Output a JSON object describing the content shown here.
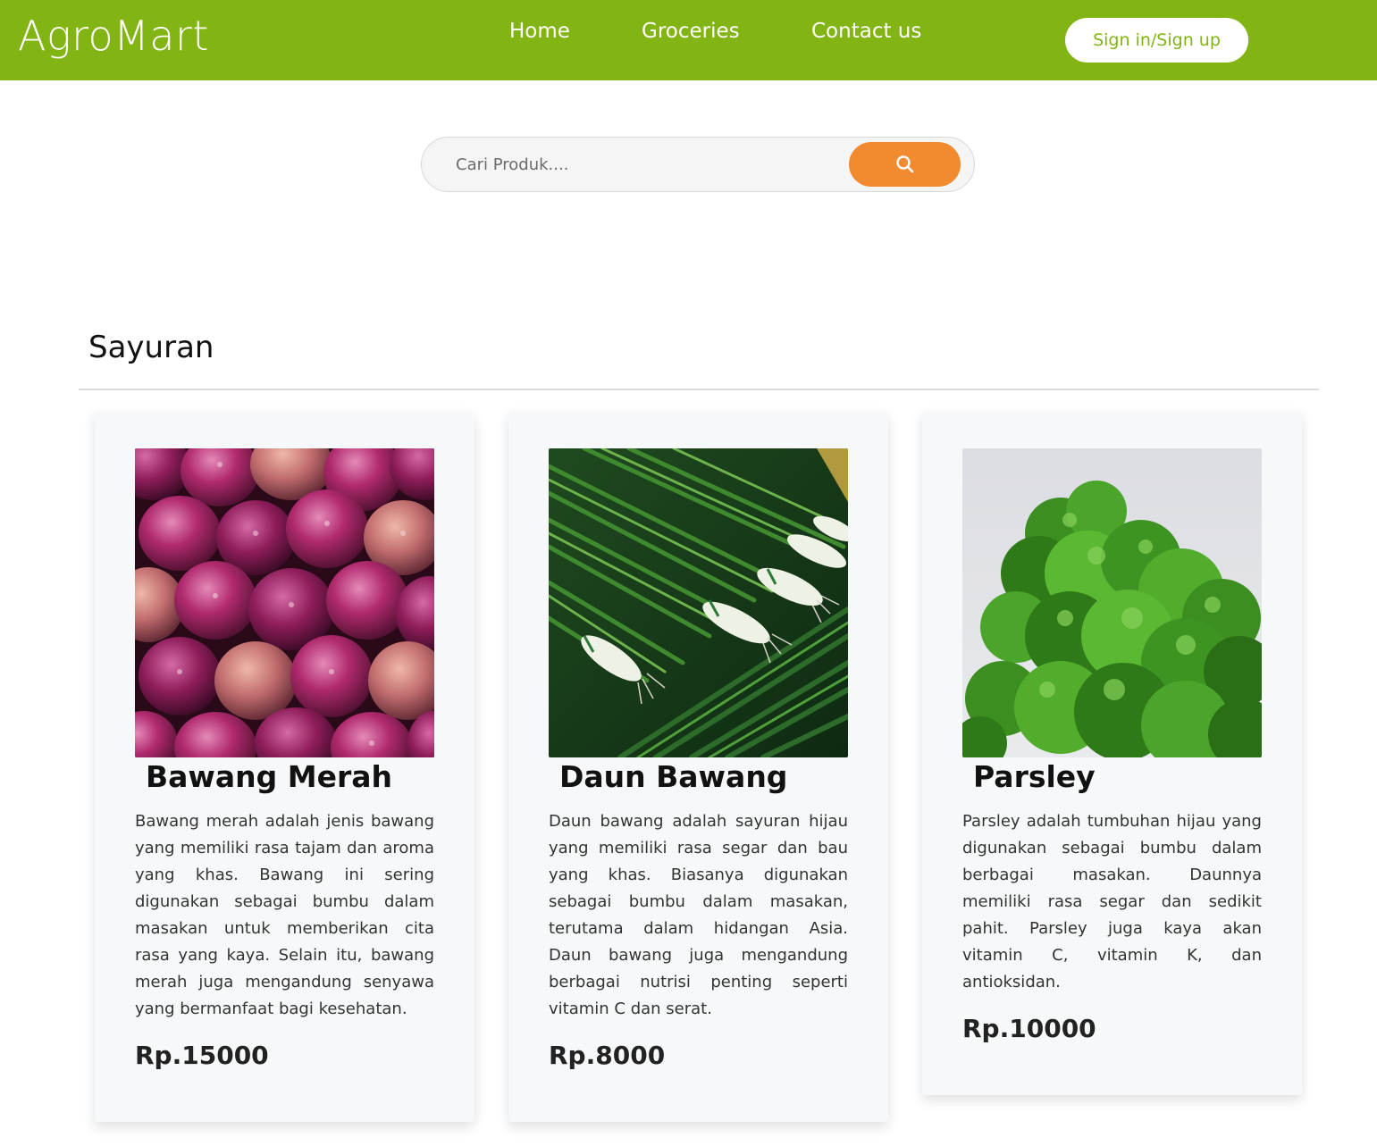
{
  "navbar": {
    "brand": "AgroMart",
    "links": [
      "Home",
      "Groceries",
      "Contact us"
    ],
    "signin_label": "Sign in/Sign up",
    "bg_color": "#82b414"
  },
  "search": {
    "placeholder": "Cari Produk....",
    "value": "",
    "button_icon": "search-icon",
    "button_color": "#f28a30"
  },
  "section": {
    "title": "Sayuran"
  },
  "products": [
    {
      "name": "Bawang Merah",
      "image": "red-onions-photo",
      "description": "Bawang merah adalah jenis bawang yang memiliki rasa tajam dan aroma yang khas. Bawang ini sering digunakan sebagai bumbu dalam masakan untuk memberikan cita rasa yang kaya. Selain itu, bawang merah juga mengandung senyawa yang bermanfaat bagi kesehatan.",
      "price": "Rp.15000"
    },
    {
      "name": "Daun Bawang",
      "image": "green-onions-photo",
      "description": "Daun bawang adalah sayuran hijau yang memiliki rasa segar dan bau yang khas. Biasanya digunakan sebagai bumbu dalam masakan, terutama dalam hidangan Asia. Daun bawang juga mengandung berbagai nutrisi penting seperti vitamin C dan serat.",
      "price": "Rp.8000"
    },
    {
      "name": "Parsley",
      "image": "parsley-photo",
      "description": "Parsley adalah tumbuhan hijau yang digunakan sebagai bumbu dalam berbagai masakan. Daunnya memiliki rasa segar dan sedikit pahit. Parsley juga kaya akan vitamin C, vitamin K, dan antioksidan.",
      "price": "Rp.10000"
    }
  ]
}
